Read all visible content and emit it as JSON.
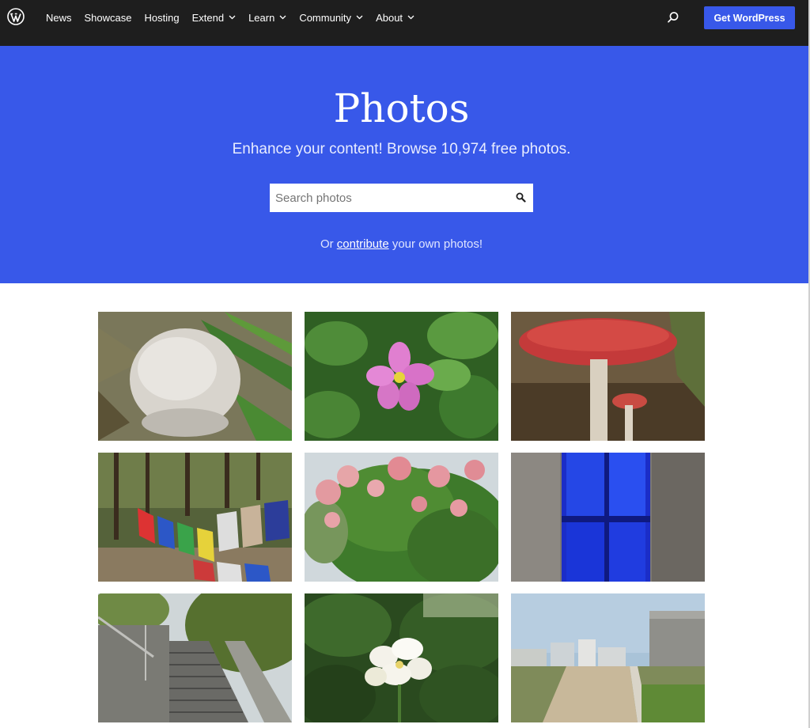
{
  "nav": {
    "items": [
      {
        "label": "News",
        "has_dropdown": false
      },
      {
        "label": "Showcase",
        "has_dropdown": false
      },
      {
        "label": "Hosting",
        "has_dropdown": false
      },
      {
        "label": "Extend",
        "has_dropdown": true
      },
      {
        "label": "Learn",
        "has_dropdown": true
      },
      {
        "label": "Community",
        "has_dropdown": true
      },
      {
        "label": "About",
        "has_dropdown": true
      }
    ],
    "cta_label": "Get WordPress"
  },
  "hero": {
    "title": "Photos",
    "subtitle": "Enhance your content! Browse 10,974 free photos.",
    "search_placeholder": "Search photos",
    "contribute_prefix": "Or ",
    "contribute_link": "contribute",
    "contribute_suffix": " your own photos!"
  },
  "colors": {
    "brand_blue": "#3858e9",
    "nav_bg": "#1e1e1e"
  },
  "photos": [
    {
      "subject": "white puffball mushroom in grass"
    },
    {
      "subject": "pink flower among green leaves"
    },
    {
      "subject": "red fly agaric mushroom"
    },
    {
      "subject": "prayer flags strung between pine trees"
    },
    {
      "subject": "pink flowering shrub"
    },
    {
      "subject": "blue lattice window in concrete wall"
    },
    {
      "subject": "stone staircase with railing"
    },
    {
      "subject": "white flowers in garden"
    },
    {
      "subject": "dirt road beside buildings"
    }
  ]
}
